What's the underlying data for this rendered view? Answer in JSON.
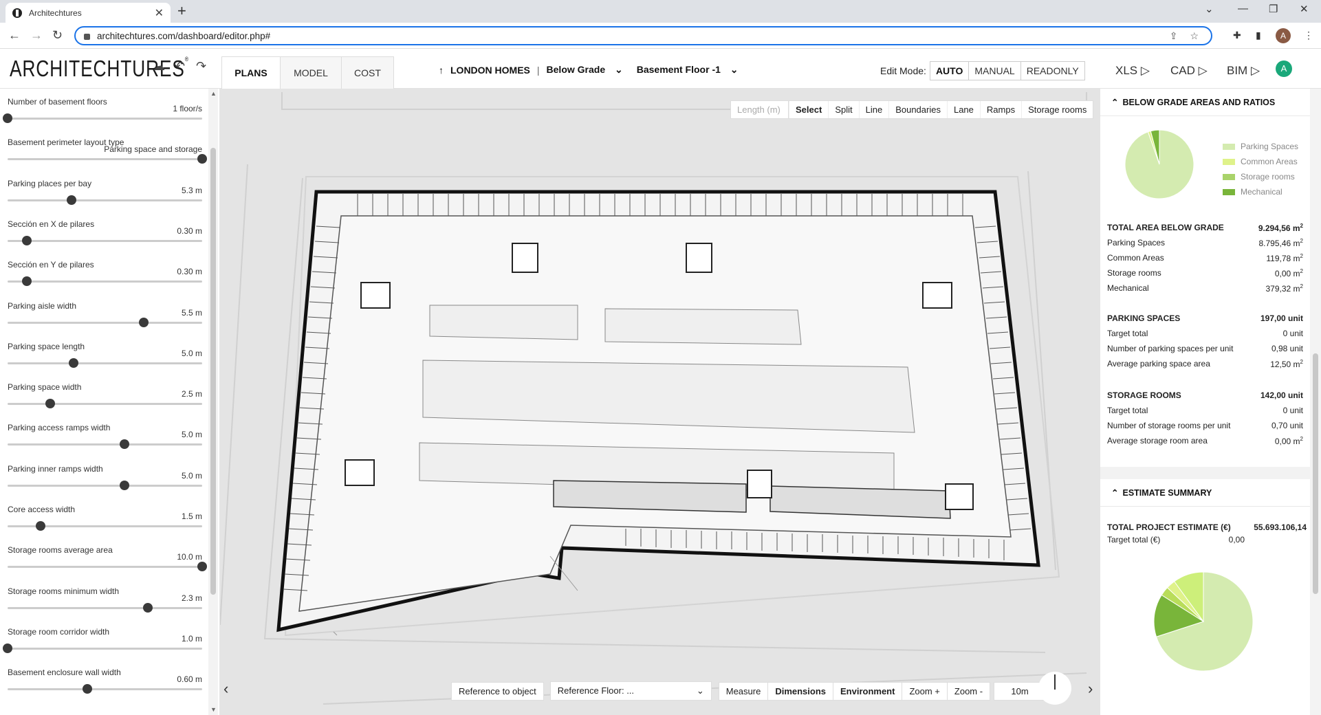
{
  "browser": {
    "tab_title": "Architechtures",
    "url": "architechtures.com/dashboard/editor.php#"
  },
  "header": {
    "logo": "ARCHITECHTURES",
    "tabs": [
      "PLANS",
      "MODEL",
      "COST"
    ],
    "active_tab": "PLANS",
    "project": "LONDON HOMES",
    "separator": "|",
    "level": "Below Grade",
    "floor": "Basement Floor -1",
    "edit_mode_label": "Edit Mode:",
    "edit_modes": [
      "AUTO",
      "MANUAL",
      "READONLY"
    ],
    "active_edit_mode": "AUTO",
    "exports": [
      "XLS",
      "CAD",
      "BIM"
    ],
    "avatar_letter": "A",
    "profile_letter": "A"
  },
  "params": [
    {
      "label": "Number of basement floors",
      "value": "1 floor/s",
      "fraction": 0.0
    },
    {
      "label": "Basement perimeter layout type",
      "value": "Parking space and storage",
      "fraction": 1.0
    },
    {
      "label": "Parking places per bay",
      "value": "5.3 m",
      "fraction": 0.33
    },
    {
      "label": "Sección en X de pilares",
      "value": "0.30 m",
      "fraction": 0.1
    },
    {
      "label": "Sección en Y de pilares",
      "value": "0.30 m",
      "fraction": 0.1
    },
    {
      "label": "Parking aisle width",
      "value": "5.5 m",
      "fraction": 0.7
    },
    {
      "label": "Parking space length",
      "value": "5.0 m",
      "fraction": 0.34
    },
    {
      "label": "Parking space width",
      "value": "2.5 m",
      "fraction": 0.22
    },
    {
      "label": "Parking access ramps width",
      "value": "5.0 m",
      "fraction": 0.6
    },
    {
      "label": "Parking inner ramps width",
      "value": "5.0 m",
      "fraction": 0.6
    },
    {
      "label": "Core access width",
      "value": "1.5 m",
      "fraction": 0.17
    },
    {
      "label": "Storage rooms average area",
      "value": "10.0 m",
      "fraction": 1.0
    },
    {
      "label": "Storage rooms minimum width",
      "value": "2.3 m",
      "fraction": 0.72
    },
    {
      "label": "Storage room corridor width",
      "value": "1.0 m",
      "fraction": 0.0
    },
    {
      "label": "Basement enclosure wall width",
      "value": "0.60 m",
      "fraction": 0.41
    }
  ],
  "toolbar": {
    "length_placeholder": "Length (m)",
    "tools": [
      "Select",
      "Split",
      "Line",
      "Boundaries",
      "Lane",
      "Ramps",
      "Storage rooms"
    ],
    "active_tool": "Select"
  },
  "bottombar": {
    "reference_object": "Reference to object",
    "reference_floor_label": "Reference Floor:",
    "reference_floor_value": "...",
    "buttons": [
      "Measure",
      "Dimensions",
      "Environment",
      "Zoom +",
      "Zoom -"
    ],
    "scale": "10m"
  },
  "areas": {
    "title": "BELOW GRADE AREAS AND RATIOS",
    "legend": [
      {
        "name": "Parking Spaces",
        "color": "#d4ebb0"
      },
      {
        "name": "Common Areas",
        "color": "#dff28a"
      },
      {
        "name": "Storage rooms",
        "color": "#a9d36a"
      },
      {
        "name": "Mechanical",
        "color": "#79b53a"
      }
    ],
    "pie_values": [
      8795.46,
      119.78,
      0.0,
      379.32
    ],
    "total_label": "TOTAL AREA BELOW GRADE",
    "total_value": "9.294,56 m",
    "rows": [
      {
        "label": "Parking Spaces",
        "value": "8.795,46 m"
      },
      {
        "label": "Common Areas",
        "value": "119,78 m"
      },
      {
        "label": "Storage rooms",
        "value": "0,00 m"
      },
      {
        "label": "Mechanical",
        "value": "379,32 m"
      }
    ],
    "parking_title": "PARKING SPACES",
    "parking_value": "197,00 unit",
    "parking_rows": [
      {
        "label": "Target total",
        "value": "0 unit"
      },
      {
        "label": "Number of parking spaces per unit",
        "value": "0,98 unit"
      },
      {
        "label": "Average parking space area",
        "value": "12,50 m"
      }
    ],
    "storage_title": "STORAGE ROOMS",
    "storage_value": "142,00 unit",
    "storage_rows": [
      {
        "label": "Target total",
        "value": "0 unit"
      },
      {
        "label": "Number of storage rooms per unit",
        "value": "0,70 unit"
      },
      {
        "label": "Average storage room area",
        "value": "0,00 m"
      }
    ]
  },
  "estimate": {
    "title": "ESTIMATE SUMMARY",
    "total_label": "TOTAL PROJECT ESTIMATE (€)",
    "total_value": "55.693.106,14",
    "target_label": "Target total (€)",
    "target_value": "0,00",
    "pie_values": [
      70,
      14,
      3,
      3,
      10
    ],
    "pie_colors": [
      "#d4ebb0",
      "#79b53a",
      "#b9dd5a",
      "#dff28a",
      "#cdef7a"
    ]
  }
}
